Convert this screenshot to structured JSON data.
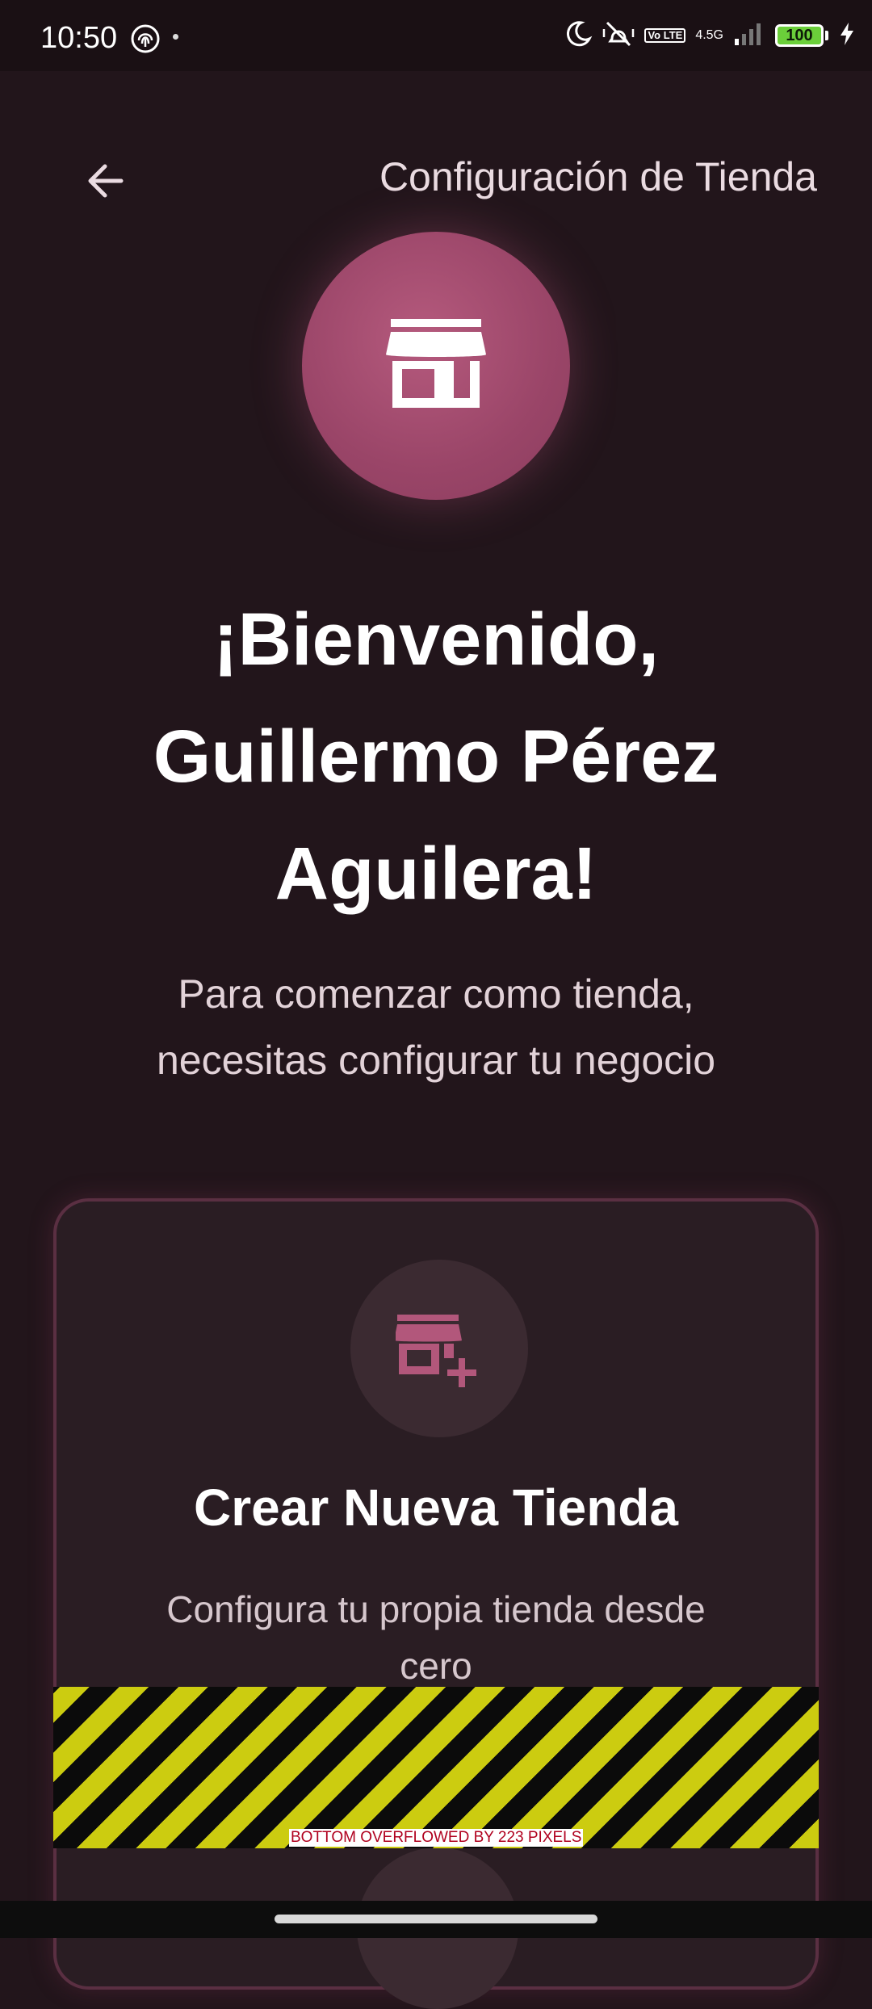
{
  "status_bar": {
    "time": "10:50",
    "network": "4.5G",
    "volte": "Vo LTE",
    "battery": "100"
  },
  "header": {
    "title": "Configuración de Tienda"
  },
  "hero": {
    "welcome_line1": "¡Bienvenido,",
    "welcome_line2": "Guillermo Pérez",
    "welcome_line3": "Aguilera!",
    "subtitle_line1": "Para comenzar como tienda,",
    "subtitle_line2": "necesitas configurar tu negocio"
  },
  "create_card": {
    "title": "Crear Nueva Tienda",
    "description_line1": "Configura tu propia tienda desde",
    "description_line2": "cero"
  },
  "overflow_warning": "BOTTOM OVERFLOWED BY 223 PIXELS",
  "colors": {
    "background": "#22151b",
    "accent": "#a24c70",
    "card_background": "#2a1d23",
    "card_border": "#5a2f42"
  }
}
